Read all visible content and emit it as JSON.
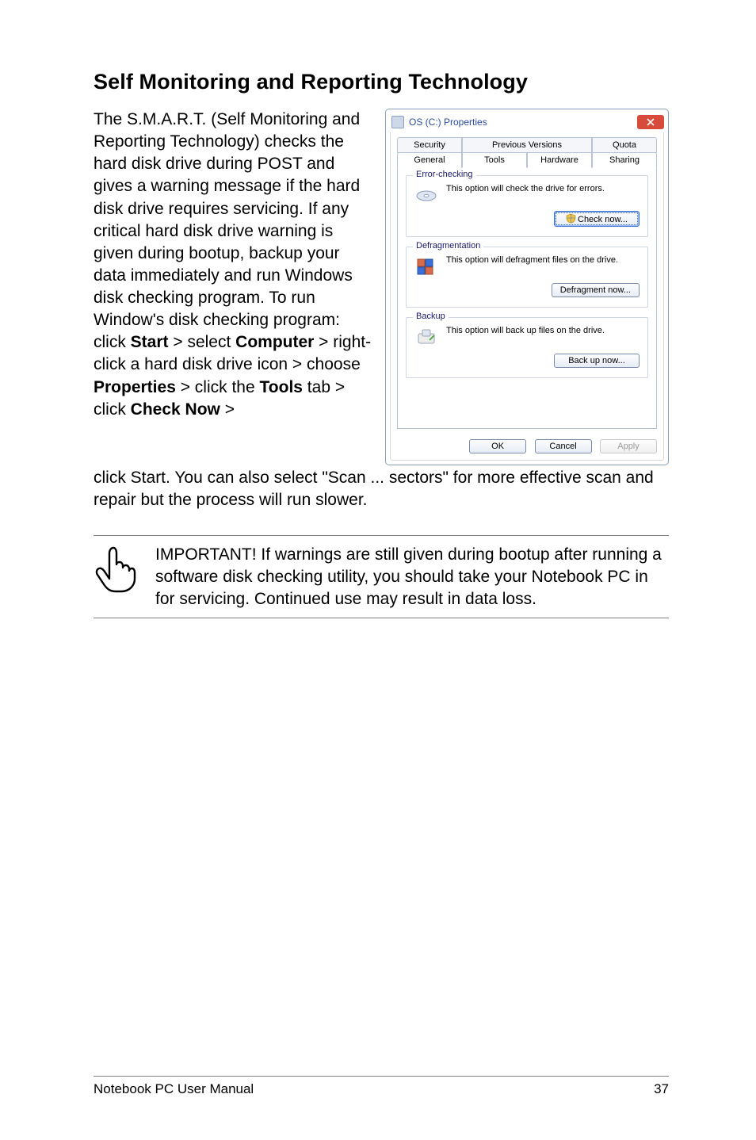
{
  "heading": "Self Monitoring and Reporting Technology",
  "body_segments": [
    {
      "t": "The S.M.A.R.T. (Self Monitoring and Reporting Technology) checks the hard disk drive during POST and gives a warning message if the hard disk drive requires servicing. If any critical hard disk drive warning is given during bootup, backup your data immediately and run Windows disk checking program. To run Window's disk checking program: click ",
      "b": false
    },
    {
      "t": "Start",
      "b": true
    },
    {
      "t": " > select ",
      "b": false
    },
    {
      "t": "Computer",
      "b": true
    },
    {
      "t": " > right-click a hard disk drive icon > choose ",
      "b": false
    },
    {
      "t": "Properties",
      "b": true
    },
    {
      "t": " > click the ",
      "b": false
    },
    {
      "t": "Tools",
      "b": true
    },
    {
      "t": " tab > click ",
      "b": false
    },
    {
      "t": "Check Now",
      "b": true
    },
    {
      "t": " > ",
      "b": false
    }
  ],
  "body_after_segments": [
    {
      "t": "click ",
      "b": false
    },
    {
      "t": "Start",
      "b": true
    },
    {
      "t": ". You can also select \"Scan ... sectors\" for more effective scan and repair but the process will run slower.",
      "b": false
    }
  ],
  "dialog": {
    "title": "OS (C:) Properties",
    "tabs_back": [
      "Security",
      "Previous Versions",
      "Quota"
    ],
    "tabs_front": [
      "General",
      "Tools",
      "Hardware",
      "Sharing"
    ],
    "active_tab": "Tools",
    "groups": {
      "error": {
        "title": "Error-checking",
        "text": "This option will check the drive for errors.",
        "button": "Check now..."
      },
      "defrag": {
        "title": "Defragmentation",
        "text": "This option will defragment files on the drive.",
        "button": "Defragment now..."
      },
      "backup": {
        "title": "Backup",
        "text": "This option will back up files on the drive.",
        "button": "Back up now..."
      }
    },
    "footer": {
      "ok": "OK",
      "cancel": "Cancel",
      "apply": "Apply"
    }
  },
  "note": "IMPORTANT! If warnings are still given during bootup after running a software disk checking utility, you should take your Notebook PC in for servicing. Continued use may result in data loss.",
  "footer_left": "Notebook PC User Manual",
  "footer_right": "37"
}
